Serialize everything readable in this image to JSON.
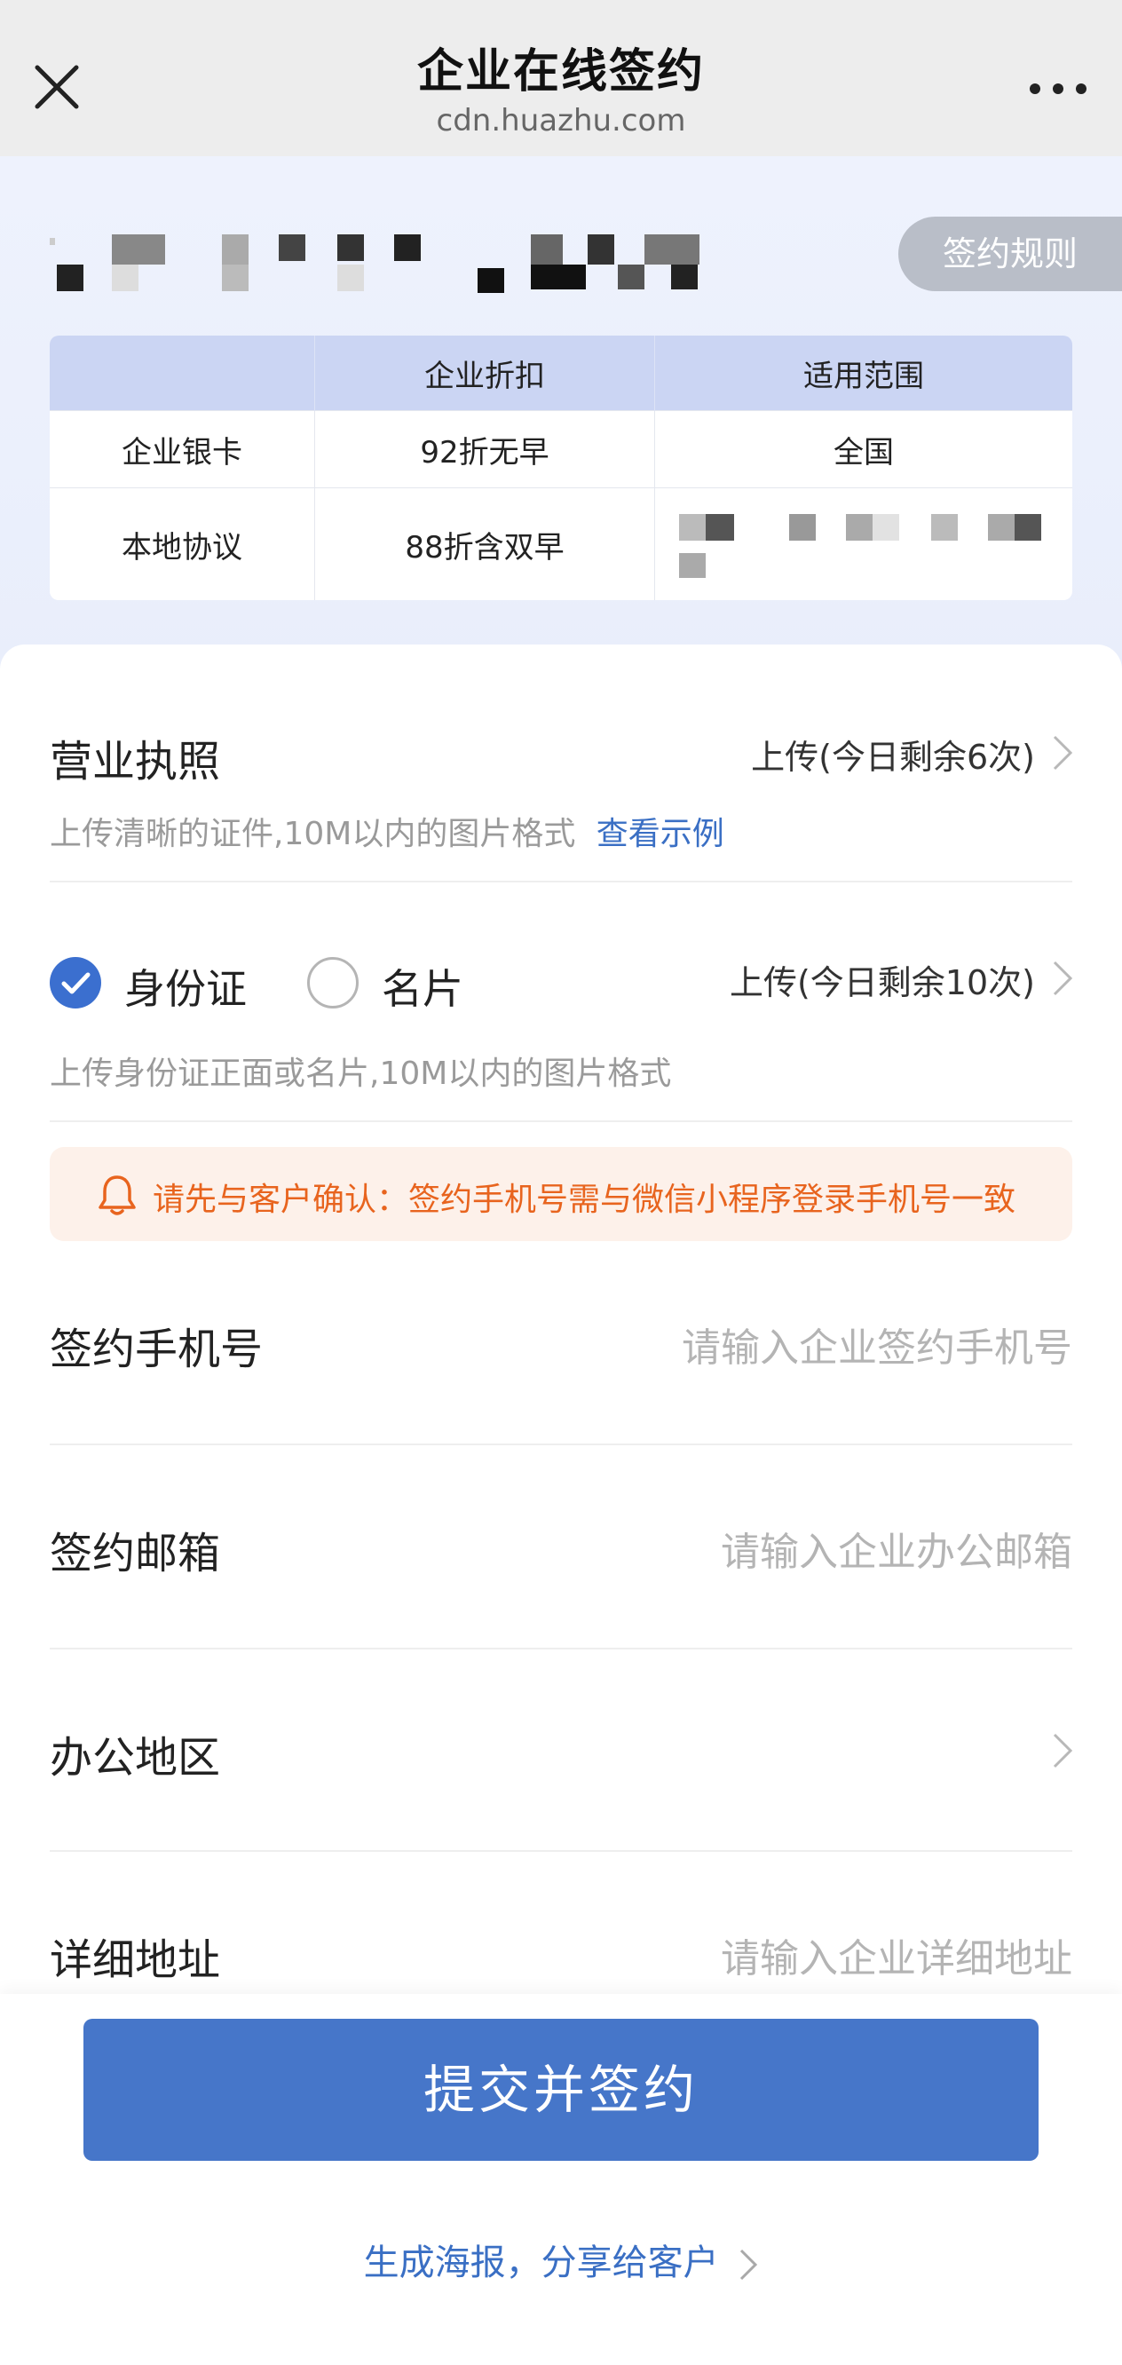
{
  "nav": {
    "title": "企业在线签约",
    "subtitle": "cdn.huazhu.com"
  },
  "header": {
    "rules_label": "签约规则"
  },
  "rate_table": {
    "columns": [
      "",
      "企业折扣",
      "适用范围"
    ],
    "rows": [
      {
        "name": "企业银卡",
        "discount": "92折无早",
        "scope": "全国"
      },
      {
        "name": "本地协议",
        "discount": "88折含双早",
        "scope": ""
      }
    ]
  },
  "form": {
    "license": {
      "title": "营业执照",
      "upload_label": "上传(今日剩余6次)",
      "hint": "上传清晰的证件,10M以内的图片格式",
      "example_link": "查看示例"
    },
    "identity": {
      "option_id": "身份证",
      "option_card": "名片",
      "selected": "身份证",
      "upload_label": "上传(今日剩余10次)",
      "hint": "上传身份证正面或名片,10M以内的图片格式"
    },
    "notice": "请先与客户确认：签约手机号需与微信小程序登录手机号一致",
    "phone": {
      "label": "签约手机号",
      "placeholder": "请输入企业签约手机号"
    },
    "email": {
      "label": "签约邮箱",
      "placeholder": "请输入企业办公邮箱"
    },
    "region": {
      "label": "办公地区"
    },
    "address": {
      "label": "详细地址",
      "placeholder": "请输入企业详细地址"
    }
  },
  "actions": {
    "submit_label": "提交并签约",
    "share_label": "生成海报，分享给客户"
  },
  "colors": {
    "accent": "#4676c9",
    "link": "#3a6fc4",
    "notice_text": "#e8641e",
    "notice_bg": "#fdf1ea"
  }
}
